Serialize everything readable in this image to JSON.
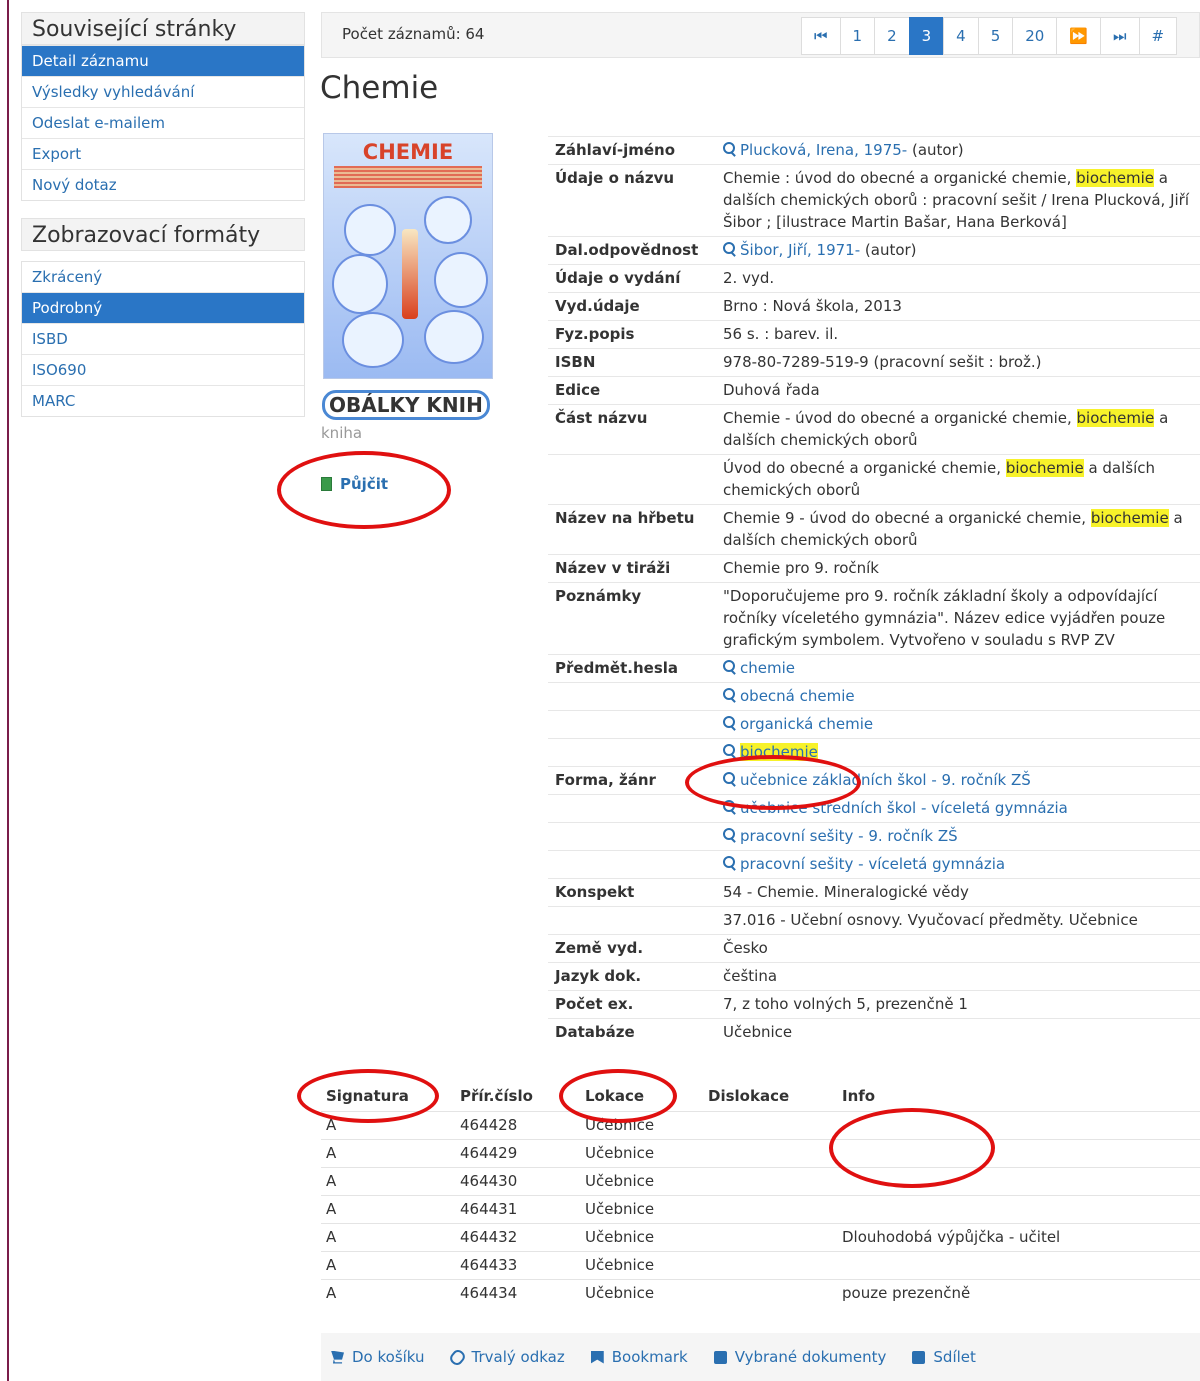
{
  "sidebar": {
    "related_title": "Související stránky",
    "related": [
      "Detail záznamu",
      "Výsledky vyhledávání",
      "Odeslat e-mailem",
      "Export",
      "Nový dotaz"
    ],
    "formats_title": "Zobrazovací formáty",
    "formats": [
      "Zkrácený",
      "Podrobný",
      "ISBD",
      "ISO690",
      "MARC"
    ]
  },
  "toolbar": {
    "record_count": "Počet záznamů: 64",
    "pages": [
      "1",
      "2",
      "3",
      "4",
      "5",
      "20"
    ],
    "first_label": "⏮",
    "prev_label": "⏪",
    "next_label": "⏩",
    "last_label": "⏭",
    "hash_label": "#"
  },
  "record": {
    "title": "Chemie",
    "cover_title": "CHEMIE",
    "cover_source": "OBÁLKY KNIH",
    "type": "kniha",
    "borrow_label": "Půjčit"
  },
  "fields": {
    "author": {
      "label": "Záhlaví-jméno",
      "link": "Plucková, Irena, 1975-",
      "role": " (autor)"
    },
    "title_info": {
      "label": "Údaje o názvu",
      "pre": "Chemie : úvod do obecné a organické chemie, ",
      "hl": "biochemie",
      "post": " a dalších chemických oborů : pracovní sešit / Irena Plucková, Jiří Šibor ; [ilustrace Martin Bašar, Hana Berková]"
    },
    "coauthor": {
      "label": "Dal.odpovědnost",
      "link": "Šibor, Jiří, 1971-",
      "role": " (autor)"
    },
    "edition": {
      "label": "Údaje o vydání",
      "value": "2. vyd."
    },
    "publication": {
      "label": "Vyd.údaje",
      "value": "Brno : Nová škola, 2013"
    },
    "physical": {
      "label": "Fyz.popis",
      "value": "56 s. : barev. il."
    },
    "isbn": {
      "label": "ISBN",
      "value": "978-80-7289-519-9 (pracovní sešit : brož.)"
    },
    "series": {
      "label": "Edice",
      "value": "Duhová řada"
    },
    "part": {
      "label": "Část názvu",
      "v1_pre": "Chemie - úvod do obecné a organické chemie, ",
      "v1_hl": "biochemie",
      "v1_post": " a dalších chemických oborů",
      "v2_pre": "Úvod do obecné a organické chemie, ",
      "v2_hl": "biochemie",
      "v2_post": " a dalších chemických oborů"
    },
    "spine": {
      "label": "Název na hřbetu",
      "pre": "Chemie 9 - úvod do obecné a organické chemie, ",
      "hl": "biochemie",
      "post": " a dalších chemických oborů"
    },
    "colophon": {
      "label": "Název v tiráži",
      "value": "Chemie pro 9. ročník"
    },
    "notes": {
      "label": "Poznámky",
      "value": "\"Doporučujeme pro 9. ročník základní školy a odpovídající ročníky víceletého gymnázia\". Název edice vyjádřen pouze grafickým symbolem. Vytvořeno v souladu s RVP ZV"
    },
    "subjects": {
      "label": "Předmět.hesla",
      "s1": "chemie",
      "s2": "obecná chemie",
      "s3": "organická chemie",
      "s4": "biochemie"
    },
    "genre": {
      "label": "Forma, žánr",
      "g1": "učebnice základních škol - 9. ročník ZŠ",
      "g2": "učebnice středních škol - víceletá gymnázia",
      "g3": "pracovní sešity - 9. ročník ZŠ",
      "g4": "pracovní sešity - víceletá gymnázia"
    },
    "conspectus": {
      "label": "Konspekt",
      "v1": "54 - Chemie. Mineralogické vědy",
      "v2": "37.016 - Učební osnovy. Vyučovací předměty. Učebnice"
    },
    "country": {
      "label": "Země vyd.",
      "value": "Česko"
    },
    "language": {
      "label": "Jazyk dok.",
      "value": "čeština"
    },
    "copies": {
      "label": "Počet ex.",
      "value": "7, z toho volných 5, prezenčně 1"
    },
    "database": {
      "label": "Databáze",
      "value": "Učebnice"
    }
  },
  "items": {
    "headers": {
      "signatura": "Signatura",
      "number": "Přír.číslo",
      "location": "Lokace",
      "dislocation": "Dislokace",
      "info": "Info"
    },
    "rows": [
      {
        "signatura": "A",
        "number": "464428",
        "location": "Učebnice",
        "dislocation": "",
        "info": ""
      },
      {
        "signatura": "A",
        "number": "464429",
        "location": "Učebnice",
        "dislocation": "",
        "info": ""
      },
      {
        "signatura": "A",
        "number": "464430",
        "location": "Učebnice",
        "dislocation": "",
        "info": ""
      },
      {
        "signatura": "A",
        "number": "464431",
        "location": "Učebnice",
        "dislocation": "",
        "info": ""
      },
      {
        "signatura": "A",
        "number": "464432",
        "location": "Učebnice",
        "dislocation": "",
        "info": "Dlouhodobá výpůjčka - učitel"
      },
      {
        "signatura": "A",
        "number": "464433",
        "location": "Učebnice",
        "dislocation": "",
        "info": ""
      },
      {
        "signatura": "A",
        "number": "464434",
        "location": "Učebnice",
        "dislocation": "",
        "info": "pouze prezenčně"
      }
    ]
  },
  "actions": {
    "cart": "Do košíku",
    "permalink": "Trvalý odkaz",
    "bookmark": "Bookmark",
    "selected": "Vybrané dokumenty",
    "share": "Sdílet"
  },
  "colors": {
    "accent": "#2a76c6",
    "link": "#2a6fb0",
    "highlight": "#f7f22a",
    "annotation": "#e01010"
  }
}
